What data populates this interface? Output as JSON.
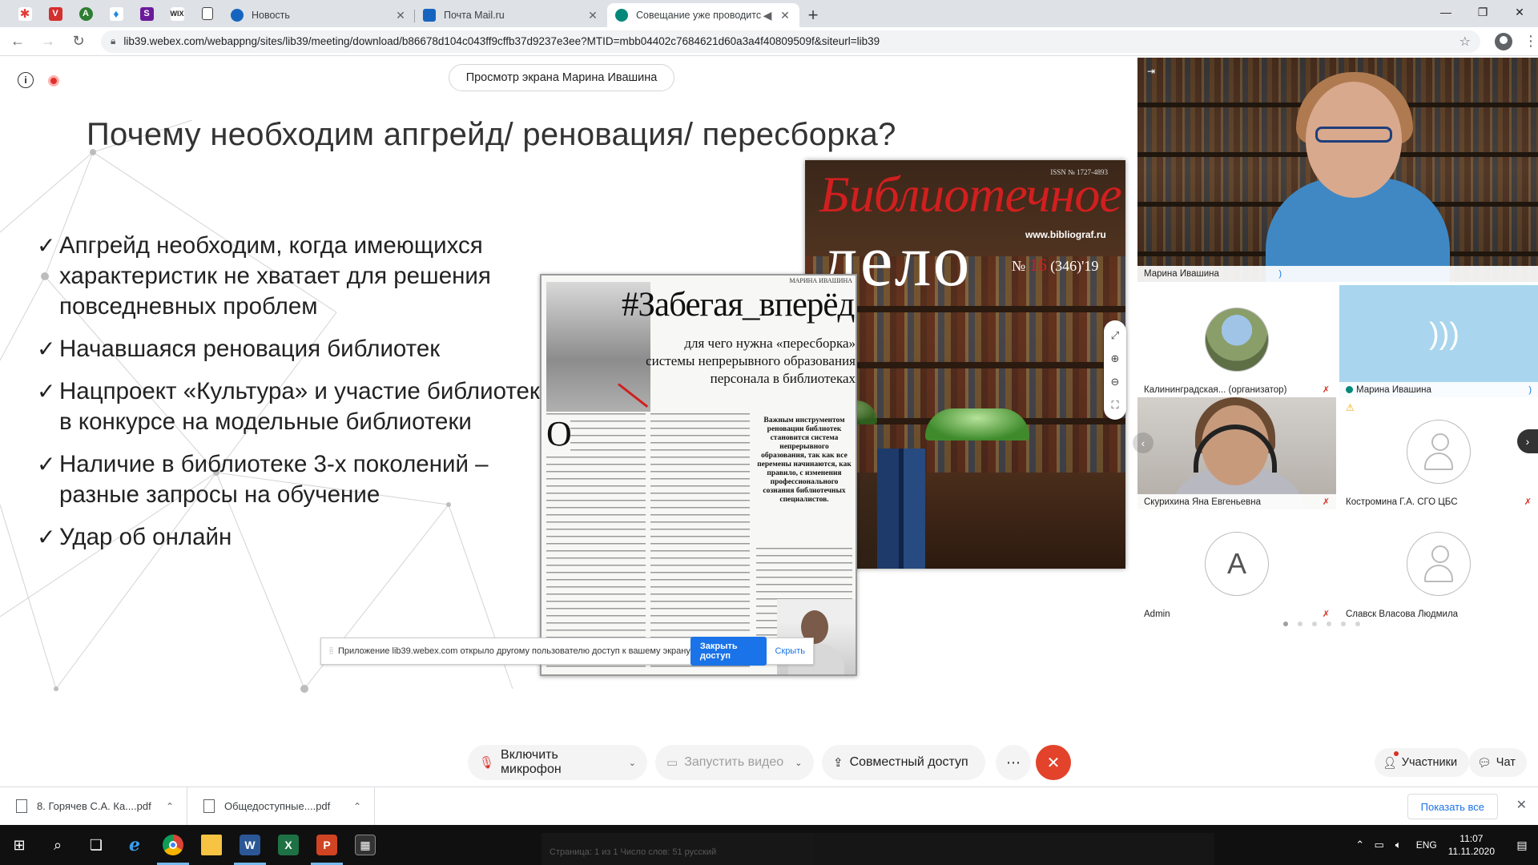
{
  "browser": {
    "pinned_tabs": [
      {
        "icon": "pinwheel-icon",
        "glyph": "✱",
        "color": "#e53935"
      },
      {
        "icon": "vivaldi-shield-icon",
        "glyph": "V",
        "color": "#d32f2f"
      },
      {
        "icon": "leaf-icon",
        "glyph": "A",
        "color": "#2e7d32"
      },
      {
        "icon": "drop-icon",
        "glyph": "♦",
        "color": "#1e88e5"
      },
      {
        "icon": "steam-icon",
        "glyph": "S",
        "color": "#6a1b9a"
      },
      {
        "icon": "wix-icon",
        "glyph": "WIX",
        "color": "#212121"
      },
      {
        "icon": "book-icon",
        "glyph": "▯",
        "color": "#424242"
      }
    ],
    "tabs": [
      {
        "title": "Новость",
        "favicon_color": "#1565c0",
        "active": false
      },
      {
        "title": "Почта Mail.ru",
        "favicon_color": "#1565c0",
        "active": false
      },
      {
        "title": "Совещание уже проводитс",
        "favicon_color": "#00897b",
        "active": true
      }
    ],
    "url": "lib39.webex.com/webappng/sites/lib39/meeting/download/b86678d104c043ff9cffb37d9237e3ee?MTID=mbb04402c7684621d60a3a4f40809509f&siteurl=lib39"
  },
  "meeting": {
    "share_label": "Просмотр экрана Марина Ивашина",
    "slide": {
      "title": "Почему необходим апгрейд/ реновация/ пересборка?",
      "bullets": [
        "Апгрейд необходим, когда имеющихся характеристик не хватает для решения повседневных проблем",
        "Начавшаяся реновация библиотек",
        "Нацпроект «Культура» и участие библиотек в конкурсе на модельные библиотеки",
        "Наличие в библиотеке 3-х поколений – разные запросы на обучение",
        "Удар об онлайн"
      ],
      "magazine": {
        "issn": "ISSN № 1727-4893",
        "title_top": "Библиотечное",
        "title_bottom": "дело",
        "site": "www.bibliograf.ru",
        "issue_prefix": "№",
        "issue_num": "16",
        "issue_total": "(346)'19"
      },
      "article": {
        "author": "МАРИНА ИВАШИНА",
        "headline": "#Забегая_вперёд:",
        "subheadline": "для чего нужна «пересборка» системы непрерывного образования персонала в библиотеках",
        "dropcap": "О",
        "quote": "Важным инструментом реновации библиотек становится система непрерывного образования, так как все перемены начинаются, как правило, с изменения профессионального сознания библиотечных специалистов."
      }
    },
    "share_notice": {
      "text": "Приложение lib39.webex.com открыло другому пользователю доступ к вашему экрану",
      "stop_label": "Закрыть доступ",
      "hide_label": "Скрыть"
    },
    "active_speaker": {
      "name": "Марина Ивашина"
    },
    "participants": [
      {
        "name": "Калининградская... (организатор)",
        "kind": "photo",
        "muted": true
      },
      {
        "name": "Марина Ивашина",
        "kind": "speaking",
        "muted": false
      },
      {
        "name": "Скурихина Яна Евгеньевна",
        "kind": "camera",
        "muted": true
      },
      {
        "name": "Костромина Г.А. СГО ЦБС",
        "kind": "placeholder",
        "muted": true
      },
      {
        "name": "Admin",
        "kind": "letter",
        "letter": "A",
        "muted": true
      },
      {
        "name": "Славск Власова Людмила",
        "kind": "placeholder",
        "muted": false
      }
    ],
    "pager_total": 6,
    "pager_active": 0,
    "controls": {
      "mic_label": "Включить микрофон",
      "video_label": "Запустить видео",
      "share_label": "Совместный доступ",
      "participants_label": "Участники",
      "chat_label": "Чат"
    }
  },
  "downloads": {
    "items": [
      "8. Горячев С.А. Ка....pdf",
      "Общедоступные....pdf"
    ],
    "show_all_label": "Показать все"
  },
  "taskbar": {
    "lang": "ENG",
    "time": "11:07",
    "date": "11.11.2020",
    "ghost_text": "Страница: 1 из 1    Число слов: 51    русский"
  }
}
